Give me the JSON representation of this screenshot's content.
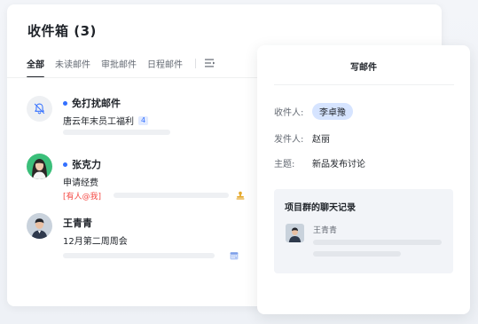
{
  "inbox": {
    "title": "收件箱 (3)",
    "tabs": [
      {
        "label": "全部",
        "active": true
      },
      {
        "label": "未读邮件",
        "active": false
      },
      {
        "label": "审批邮件",
        "active": false
      },
      {
        "label": "日程邮件",
        "active": false
      }
    ],
    "filter_icon": "filter-lines-icon",
    "messages": [
      {
        "avatar": "bell-off-icon",
        "sender": "免打扰邮件",
        "unread": true,
        "subject": "唐云年末员工福利",
        "count": "4"
      },
      {
        "avatar": "person-avatar-woman",
        "sender": "张克力",
        "unread": true,
        "subject": "申请经费",
        "mention": "[有人@我]",
        "trailing_icon": "stamp-icon"
      },
      {
        "avatar": "person-avatar-man",
        "sender": "王青青",
        "unread": false,
        "subject": "12月第二周周会",
        "trailing_icon": "calendar-icon"
      }
    ]
  },
  "compose": {
    "title": "写邮件",
    "to_label": "收件人:",
    "to_value": "李卓豫",
    "from_label": "发件人:",
    "from_value": "赵丽",
    "subject_label": "主题:",
    "subject_value": "新品发布讨论",
    "chat_record": {
      "title": "项目群的聊天记录",
      "sender": "王青青"
    }
  },
  "colors": {
    "accent": "#3370ff",
    "mention": "#f54a45",
    "chip": "#d6e4ff",
    "stamp": "#e5a92c"
  }
}
